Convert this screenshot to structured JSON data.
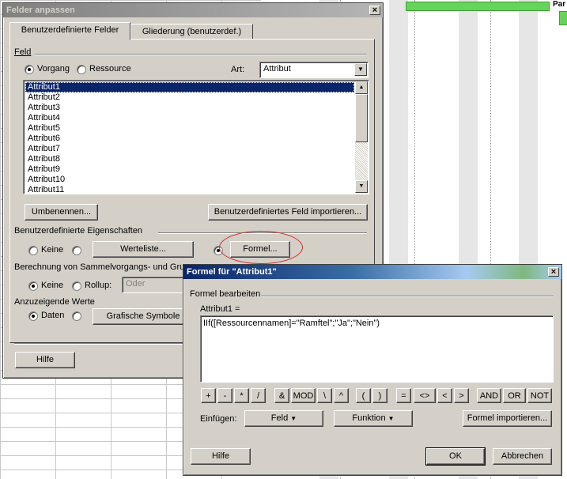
{
  "dialog_main": {
    "title": "Felder anpassen",
    "close_glyph": "×",
    "tabs": [
      {
        "label": "Benutzerdefinierte Felder"
      },
      {
        "label": "Gliederung (benutzerdef.)"
      }
    ],
    "feld_group": "Feld",
    "radio_vorgang": "Vorgang",
    "radio_ressource": "Ressource",
    "art_label": "Art:",
    "art_value": "Attribut",
    "fields": [
      "Attribut1",
      "Attribut2",
      "Attribut3",
      "Attribut4",
      "Attribut5",
      "Attribut6",
      "Attribut7",
      "Attribut8",
      "Attribut9",
      "Attribut10",
      "Attribut11"
    ],
    "rename_button": "Umbenennen...",
    "import_field_button": "Benutzerdefiniertes Feld importieren...",
    "custom_props_group": "Benutzerdefinierte Eigenschaften",
    "radio_keine_1": "Keine",
    "werteliste_button": "Werteliste...",
    "formel_button": "Formel...",
    "calc_group": "Berechnung von Sammelvorgangs- und Grup",
    "radio_keine_2": "Keine",
    "radio_rollup": "Rollup:",
    "rollup_value": "Oder",
    "display_group": "Anzuzeigende Werte",
    "radio_daten": "Daten",
    "grafische_button": "Grafische Symbole",
    "hilfe_button": "Hilfe"
  },
  "dialog_formula": {
    "title": "Formel für \"Attribut1\"",
    "close_glyph": "×",
    "edit_group": "Formel bearbeiten",
    "formula_label": "Attribut1 =",
    "formula_text": "IIf([Ressourcennamen]=\"Ramftel\";\"Ja\";\"Nein\")",
    "operators": [
      "+",
      "-",
      "*",
      "/",
      "&",
      "MOD",
      "\\",
      "^",
      "(",
      ")",
      "=",
      "<>",
      "<",
      ">",
      "AND",
      "OR",
      "NOT"
    ],
    "insert_label": "Einfügen:",
    "feld_button": "Feld",
    "funktion_button": "Funktion",
    "formel_import_button": "Formel importieren...",
    "hilfe_button": "Hilfe",
    "ok_button": "OK",
    "abbrechen_button": "Abbrechen"
  },
  "gantt": {
    "marker_text": "Par"
  },
  "colors": {
    "titlebar_active": "#0a246a",
    "selection": "#0a246a",
    "gantt_bar": "#66d45b",
    "highlight_ellipse": "#d42a2a"
  }
}
